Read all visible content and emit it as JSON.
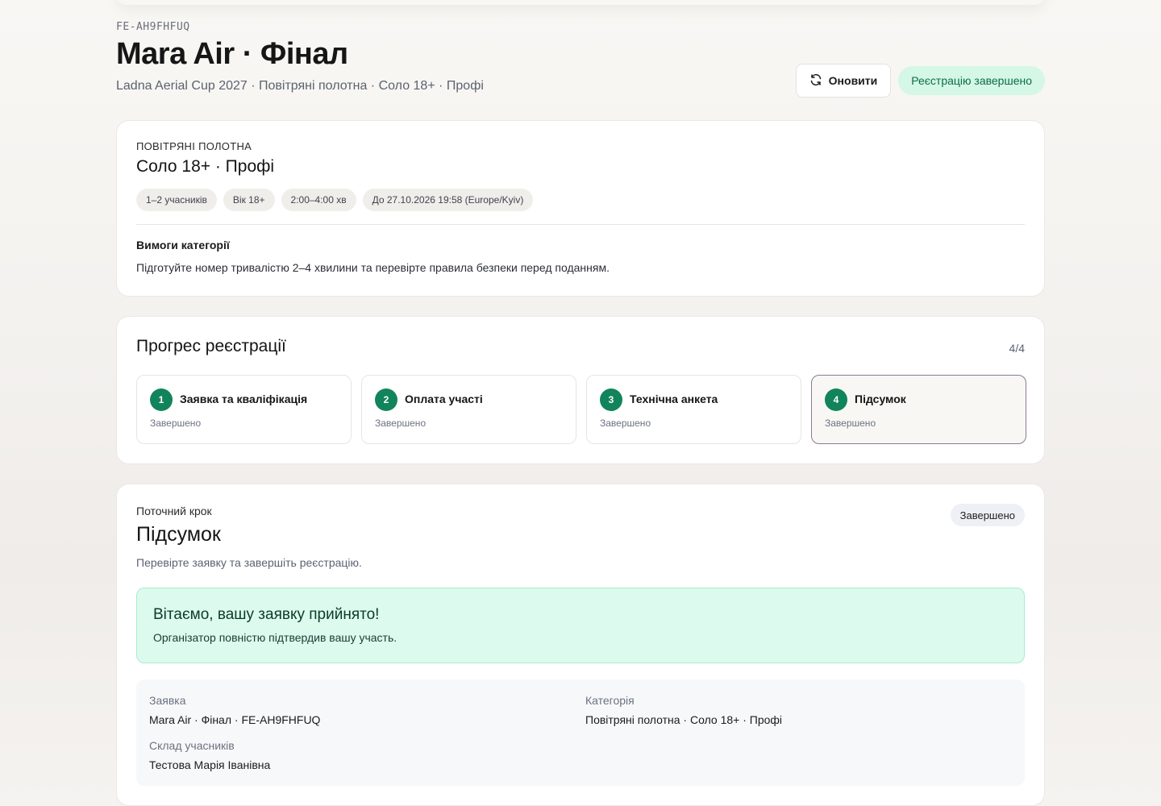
{
  "header": {
    "code": "FE-AH9FHFUQ",
    "title": "Mara Air · Фінал",
    "subtitle": "Ladna Aerial Cup 2027 · Повітряні полотна · Соло 18+ · Профі",
    "refresh_label": "Оновити",
    "status_badge": "Реєстрацію завершено"
  },
  "category_card": {
    "kicker": "ПОВІТРЯНІ ПОЛОТНА",
    "title": "Соло 18+ · Профі",
    "chips": [
      "1–2 учасників",
      "Вік 18+",
      "2:00–4:00 хв",
      "До 27.10.2026 19:58 (Europe/Kyiv)"
    ],
    "requirements_label": "Вимоги категорії",
    "requirements_text": "Підготуйте номер тривалістю 2–4 хвилини та перевірте правила безпеки перед поданням."
  },
  "progress": {
    "title": "Прогрес реєстрації",
    "count": "4/4",
    "steps": [
      {
        "num": "1",
        "title": "Заявка та кваліфікація",
        "status": "Завершено"
      },
      {
        "num": "2",
        "title": "Оплата участі",
        "status": "Завершено"
      },
      {
        "num": "3",
        "title": "Технічна анкета",
        "status": "Завершено"
      },
      {
        "num": "4",
        "title": "Підсумок",
        "status": "Завершено"
      }
    ]
  },
  "current_step": {
    "kicker": "Поточний крок",
    "title": "Підсумок",
    "description": "Перевірте заявку та завершіть реєстрацію.",
    "badge": "Завершено",
    "success_title": "Вітаємо, вашу заявку прийнято!",
    "success_text": "Організатор повністю підтвердив вашу участь.",
    "summary": {
      "application_label": "Заявка",
      "application_value": "Mara Air · Фінал · FE-AH9FHFUQ",
      "category_label": "Категорія",
      "category_value": "Повітряні полотна · Соло 18+ · Профі",
      "participants_label": "Склад учасників",
      "participants_value": "Тестова Марія Іванівна"
    }
  },
  "colors": {
    "accent_green": "#11845b",
    "success_bg": "#dcfaee",
    "badge_green_bg": "#d4f7e6",
    "active_step_border": "#8a7a96"
  },
  "icons": {
    "refresh": "refresh-icon"
  }
}
